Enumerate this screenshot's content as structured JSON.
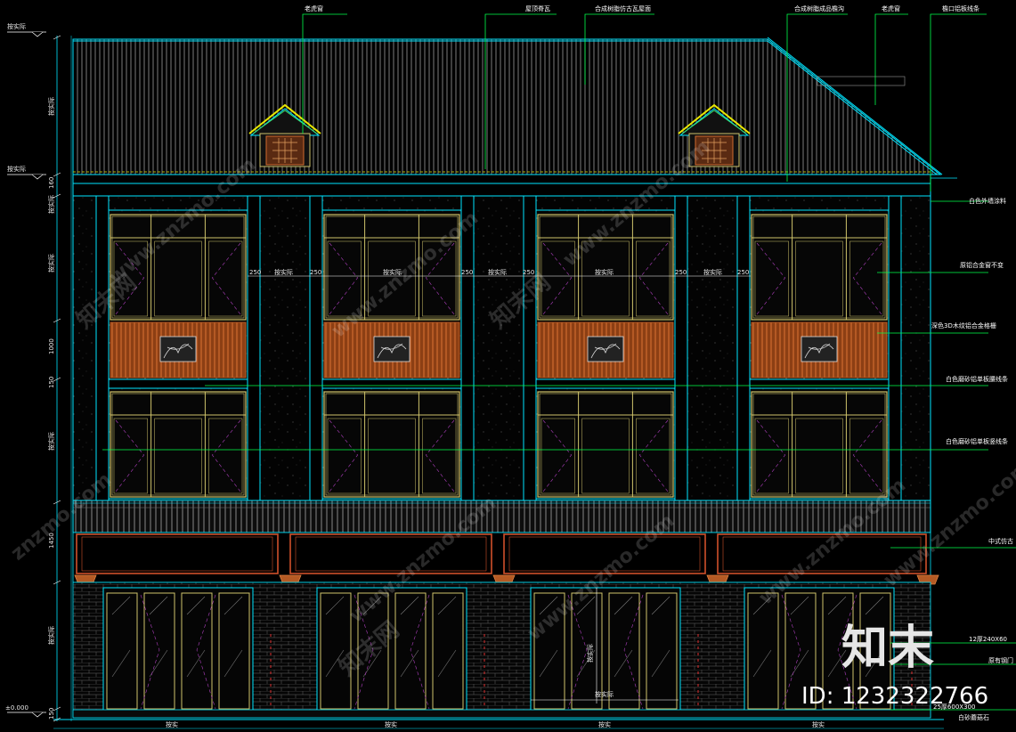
{
  "annotations": {
    "tiger_window": "老虎窗",
    "ridge_tile": "屋顶脊瓦",
    "roof_tile": "合成树脂仿古瓦屋面",
    "gutter": "合成树脂成品檐沟",
    "tiger_window_2": "老虎窗",
    "eave_line": "檐口铝板线条",
    "wall_paint": "白色外墙涂料",
    "window_alloy": "原铝合金窗不变",
    "rail_wood": "深色3D木纹铝合金格栅",
    "line_a": "白色磨砂铝单板腰线条",
    "line_b": "白色磨砂铝单板竖线条",
    "decor": "中式仿古",
    "brick": "12厚240X60",
    "door": "原有钢门",
    "base": "25厚600X300",
    "base_2": "白砂蘑菇石"
  },
  "dimensions": {
    "d250": "250",
    "verify": "按实际",
    "verify_short": "按实",
    "d1000": "1000",
    "d1450": "1450",
    "d150": "150",
    "d160": "160",
    "zero": "±0.000"
  },
  "watermarks": {
    "site": "www.znzmo.com",
    "cn": "知末网",
    "short": "znzmo.com"
  },
  "brand": {
    "logo": "知末",
    "id": "ID: 1232322766"
  },
  "colors": {
    "outline": "#00e5ff",
    "window": "#cfc36a",
    "leader": "#00ff4a",
    "wood": "#b45a24",
    "frame_red": "#d0502a",
    "brick": "#4a4a4a"
  }
}
